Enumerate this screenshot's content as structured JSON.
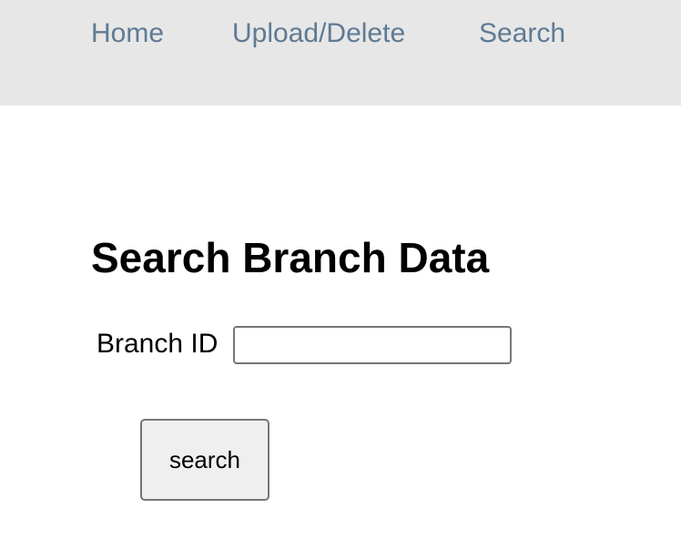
{
  "nav": {
    "items": [
      {
        "label": "Home"
      },
      {
        "label": "Upload/Delete"
      },
      {
        "label": "Search"
      }
    ]
  },
  "main": {
    "title": "Search Branch Data",
    "form": {
      "branch_id_label": "Branch ID",
      "branch_id_value": "",
      "branch_id_placeholder": "",
      "submit_label": "search"
    }
  },
  "colors": {
    "nav_background": "#e7e7e7",
    "nav_link": "#5f7a94",
    "button_background": "#efefef"
  }
}
